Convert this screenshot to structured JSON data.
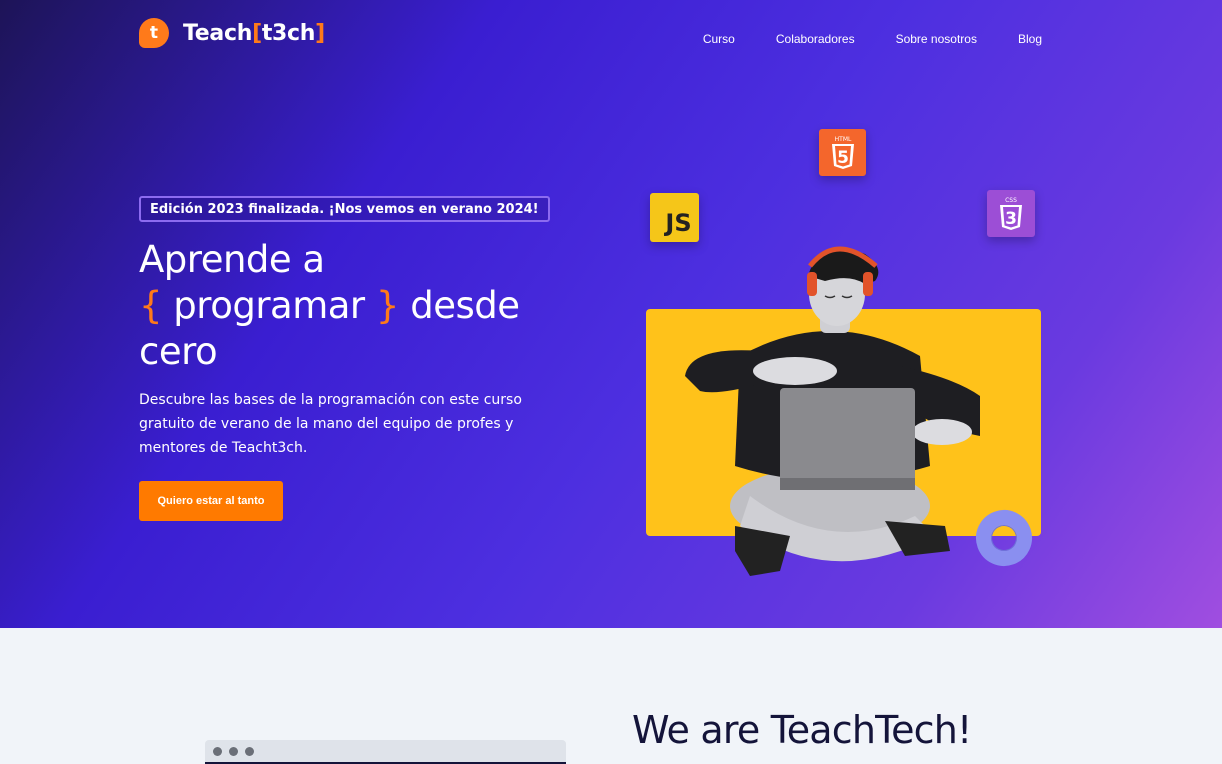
{
  "brand": {
    "mark": "t",
    "name_part1": "Teach",
    "bracket_open": "[",
    "name_part2": "t3ch",
    "bracket_close": "]"
  },
  "nav": {
    "items": [
      {
        "label": "Curso"
      },
      {
        "label": "Colaboradores"
      },
      {
        "label": "Sobre nosotros"
      },
      {
        "label": "Blog"
      }
    ]
  },
  "hero": {
    "badge": "Edición 2023 finalizada. ¡Nos vemos en verano 2024!",
    "headline_line1": "Aprende a",
    "curly_open": "{",
    "headline_highlight": " programar ",
    "curly_close": "}",
    "headline_rest": " desde",
    "headline_line3": "cero",
    "subcopy": "Descubre las bases de la programación con este curso gratuito de verano de la mano del equipo de profes y mentores de Teacht3ch.",
    "cta_label": "Quiero estar al tanto"
  },
  "tech_icons": {
    "html_caption": "HTML",
    "html_number": "5",
    "js": "JS",
    "css_caption": "CSS",
    "css_number": "3"
  },
  "about": {
    "title": "We are TeachTech!"
  },
  "colors": {
    "accent": "#ff7a1a",
    "cta": "#ff7a00",
    "hero_gradient_start": "#1d1457",
    "hero_gradient_end": "#a04ee0",
    "illustration_card": "#ffc21a"
  }
}
